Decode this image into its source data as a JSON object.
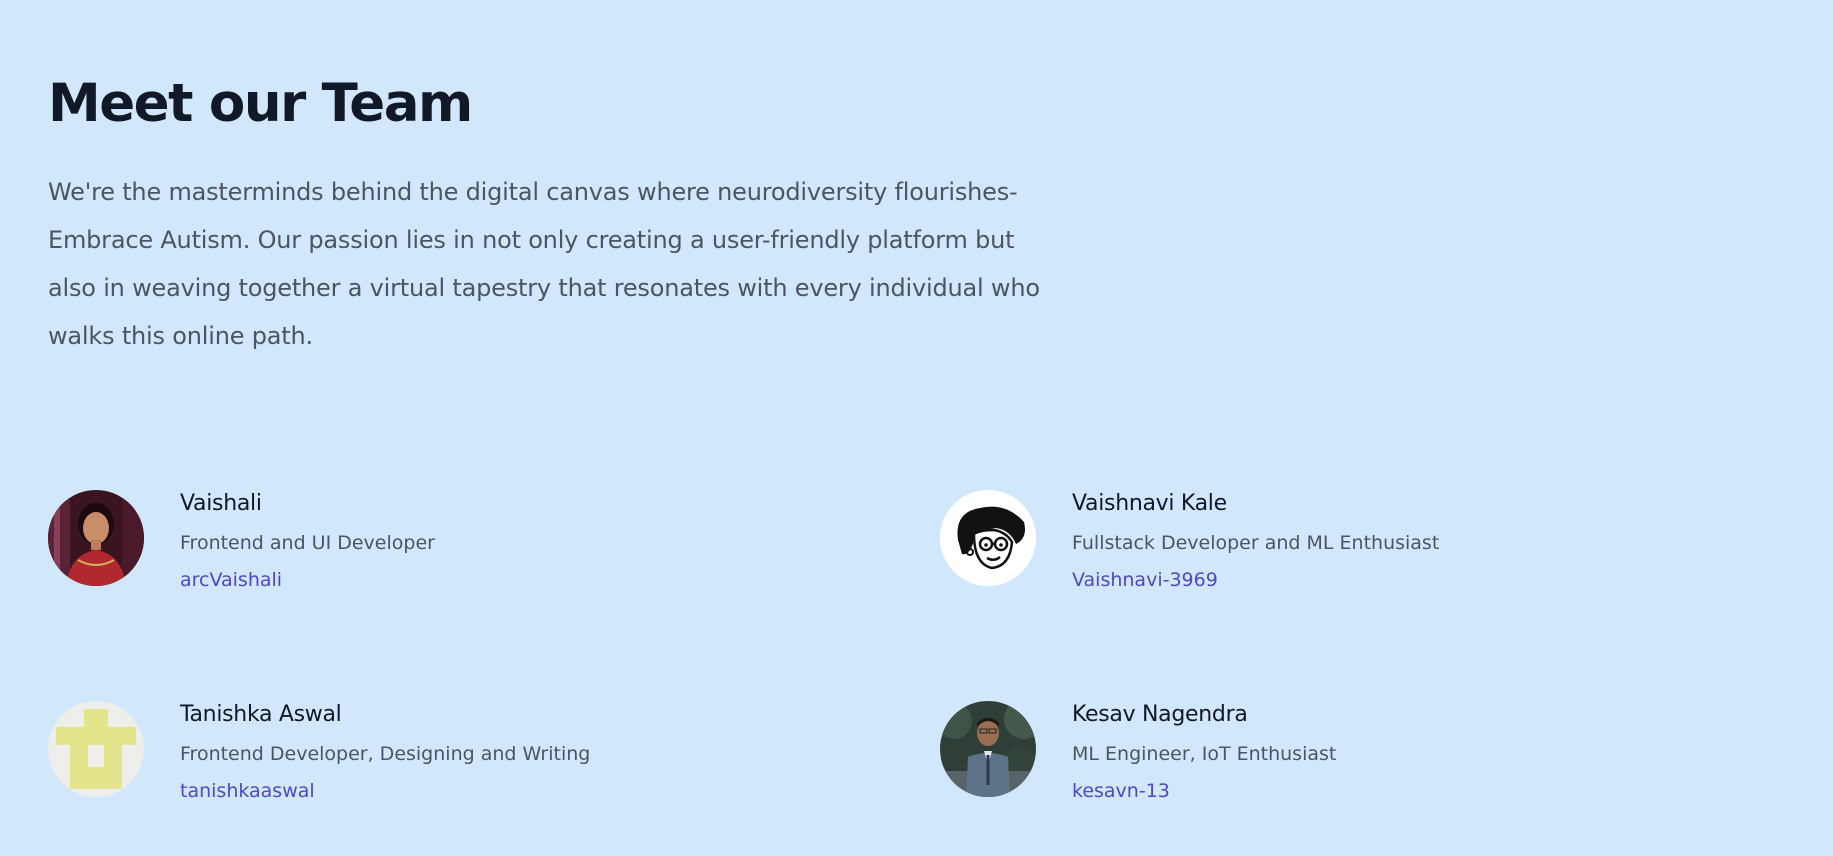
{
  "header": {
    "title": "Meet our Team",
    "intro": "We're the masterminds behind the digital canvas where neurodiversity flourishes-Embrace Autism. Our passion lies in not only creating a user-friendly platform but also in weaving together a virtual tapestry that resonates with every individual who walks this online path."
  },
  "team": [
    {
      "name": "Vaishali",
      "role": "Frontend and UI Developer",
      "handle": "arcVaishali",
      "avatar": "portrait-photo"
    },
    {
      "name": "Vaishnavi Kale",
      "role": "Fullstack Developer and ML Enthusiast",
      "handle": "Vaishnavi-3969",
      "avatar": "cartoon-face"
    },
    {
      "name": "Tanishka Aswal",
      "role": "Frontend Developer, Designing and Writing",
      "handle": "tanishkaaswal",
      "avatar": "identicon"
    },
    {
      "name": "Kesav Nagendra",
      "role": "ML Engineer, IoT Enthusiast",
      "handle": "kesavn-13",
      "avatar": "portrait-photo"
    }
  ],
  "colors": {
    "background": "#d1e7fb",
    "heading": "#111827",
    "body_text": "#4b5563",
    "link": "#4f46c8"
  }
}
